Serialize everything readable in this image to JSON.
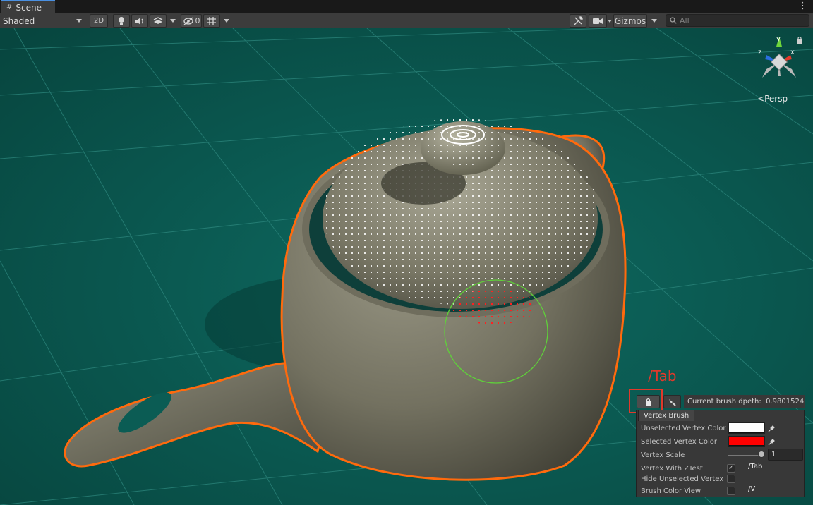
{
  "tab": {
    "label": "Scene"
  },
  "toolbar": {
    "shading": "Shaded",
    "mode_2d": "2D",
    "hidden_count": "0",
    "gizmos": "Gizmos",
    "search_placeholder": "All"
  },
  "viewport": {
    "projection": "Persp",
    "axes": {
      "x": "x",
      "y": "y",
      "z": "z"
    },
    "annotation": "/Tab"
  },
  "brush": {
    "depth_label": "Current brush dpeth:",
    "depth_value": "0.9801524",
    "panel_title": "Vertex Brush",
    "unselected_label": "Unselected Vertex Color",
    "unselected_color": "#ffffff",
    "selected_label": "Selected Vertex Color",
    "selected_color": "#ff0000",
    "scale_label": "Vertex Scale",
    "scale_value": "1",
    "scale_fraction": 1.0,
    "ztest_label": "Vertex With ZTest",
    "ztest_checked": true,
    "ztest_shortcut": "/Tab",
    "hide_label": "Hide Unselected Vertex",
    "hide_checked": false,
    "color_view_label": "Brush Color View",
    "color_view_checked": false,
    "color_view_shortcut": "/V"
  },
  "colors": {
    "ground": "#0b5c54",
    "selection_outline": "#ff6a0d",
    "brush_circle": "#5fd13a",
    "annotation_red": "#e0392b",
    "teapot": "#7d7b6b"
  },
  "icons": [
    "grid-icon",
    "more-icon",
    "light-icon",
    "audio-icon",
    "effects-icon",
    "visibility-icon",
    "grid-toggle-icon",
    "tools-icon",
    "camera-icon",
    "search-icon",
    "lock-icon",
    "brush-icon",
    "eyedropper-icon",
    "checkmark-icon"
  ]
}
